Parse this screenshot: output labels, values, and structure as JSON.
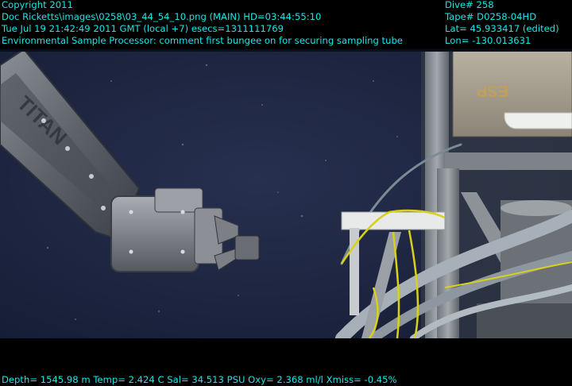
{
  "overlay": {
    "copyright": "Copyright 2011",
    "file": "Doc Ricketts\\images\\0258\\03_44_54_10.png (MAIN)  HD=03:44:55:10",
    "datetime": "Tue Jul 19 21:42:49 2011 GMT (local +7)  esecs=1311111769",
    "caption": "Environmental Sample Processor: comment first bungee on for securing sampling tube",
    "dive": "Dive# 258",
    "tape": "Tape# D0258-04HD",
    "lat": "Lat= 45.933417 (edited)",
    "lon": "Lon= -130.013631",
    "sensors": "Depth= 1545.98 m  Temp= 2.424 C  Sal= 34.513 PSU  Oxy= 2.368 ml/l  Xmiss= -0.45%"
  },
  "scene": {
    "arm_label": "TITAN",
    "equipment_label": "ESP",
    "water_color": "#1c2642",
    "bungee_color": "#d8d11a",
    "overlay_text_color": "#19e6e6"
  }
}
